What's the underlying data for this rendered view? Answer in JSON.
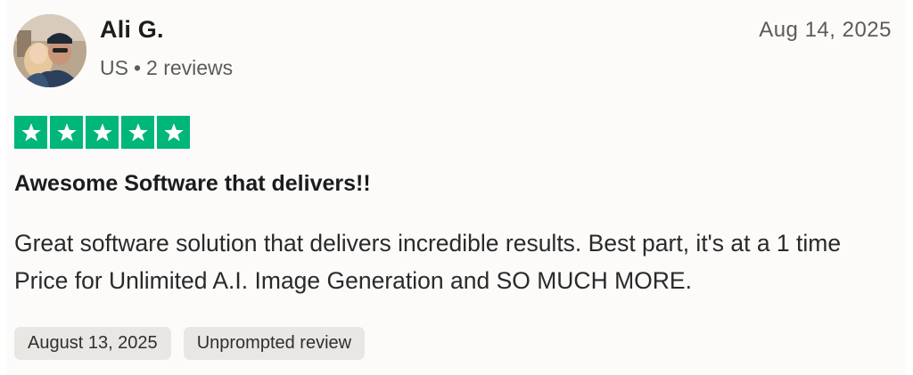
{
  "reviewer": {
    "name": "Ali G.",
    "country": "US",
    "separator": "•",
    "reviews_count": "2 reviews"
  },
  "review": {
    "date": "Aug 14, 2025",
    "rating": 5,
    "max_rating": 5,
    "star_color": "#00b67a",
    "title": "Awesome Software that delivers!!",
    "body": "Great software solution that delivers incredible results. Best part, it's at a 1 time Price for Unlimited A.I. Image Generation and SO MUCH MORE."
  },
  "tags": {
    "experience_date": "August 13, 2025",
    "review_type": "Unprompted review"
  },
  "icons": {
    "star": "star-icon",
    "avatar": "profile-photo"
  }
}
